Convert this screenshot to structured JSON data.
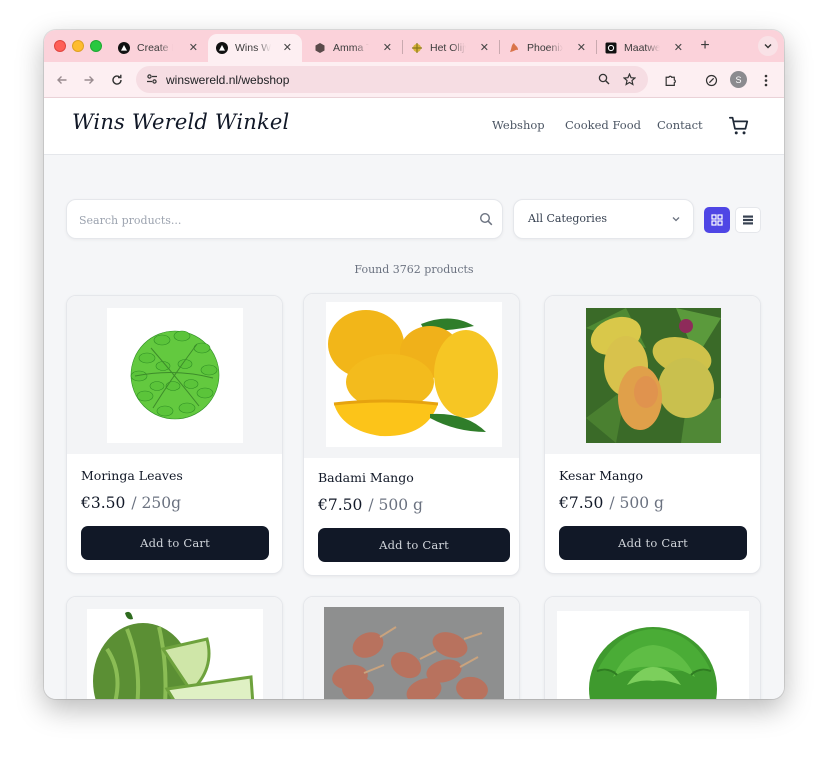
{
  "browser": {
    "tabs": [
      {
        "title": "Create Ne",
        "icon": "vercel-icon",
        "active": false
      },
      {
        "title": "Wins Wer",
        "icon": "vercel-icon",
        "active": true
      },
      {
        "title": "Amma Ta",
        "icon": "hexagon-icon",
        "active": false
      },
      {
        "title": "Het Olijvu",
        "icon": "olive-icon",
        "active": false
      },
      {
        "title": "Phoenix I",
        "icon": "phoenix-icon",
        "active": false
      },
      {
        "title": "Maatwerk",
        "icon": "dark-square-icon",
        "active": false
      }
    ],
    "url": "winswereld.nl/webshop",
    "profile_initial": "S"
  },
  "site": {
    "logo": "Wins Wereld Winkel",
    "nav": [
      "Webshop",
      "Cooked Food",
      "Contact"
    ]
  },
  "filters": {
    "search_placeholder": "Search products...",
    "category_label": "All Categories"
  },
  "results": {
    "count_text": "Found 3762 products"
  },
  "products": [
    {
      "name": "Moringa Leaves",
      "price": "€3.50",
      "unit": "/ 250g",
      "button": "Add to Cart"
    },
    {
      "name": "Badami Mango",
      "price": "€7.50",
      "unit": "/ 500 g",
      "button": "Add to Cart"
    },
    {
      "name": "Kesar Mango",
      "price": "€7.50",
      "unit": "/ 500 g",
      "button": "Add to Cart"
    },
    {
      "name": "",
      "price": "",
      "unit": "",
      "button": ""
    },
    {
      "name": "",
      "price": "",
      "unit": "",
      "button": ""
    },
    {
      "name": "",
      "price": "",
      "unit": "",
      "button": ""
    }
  ],
  "colors": {
    "tabstrip": "#fbd2da",
    "accent": "#4f46e5",
    "button_dark": "#111827"
  }
}
